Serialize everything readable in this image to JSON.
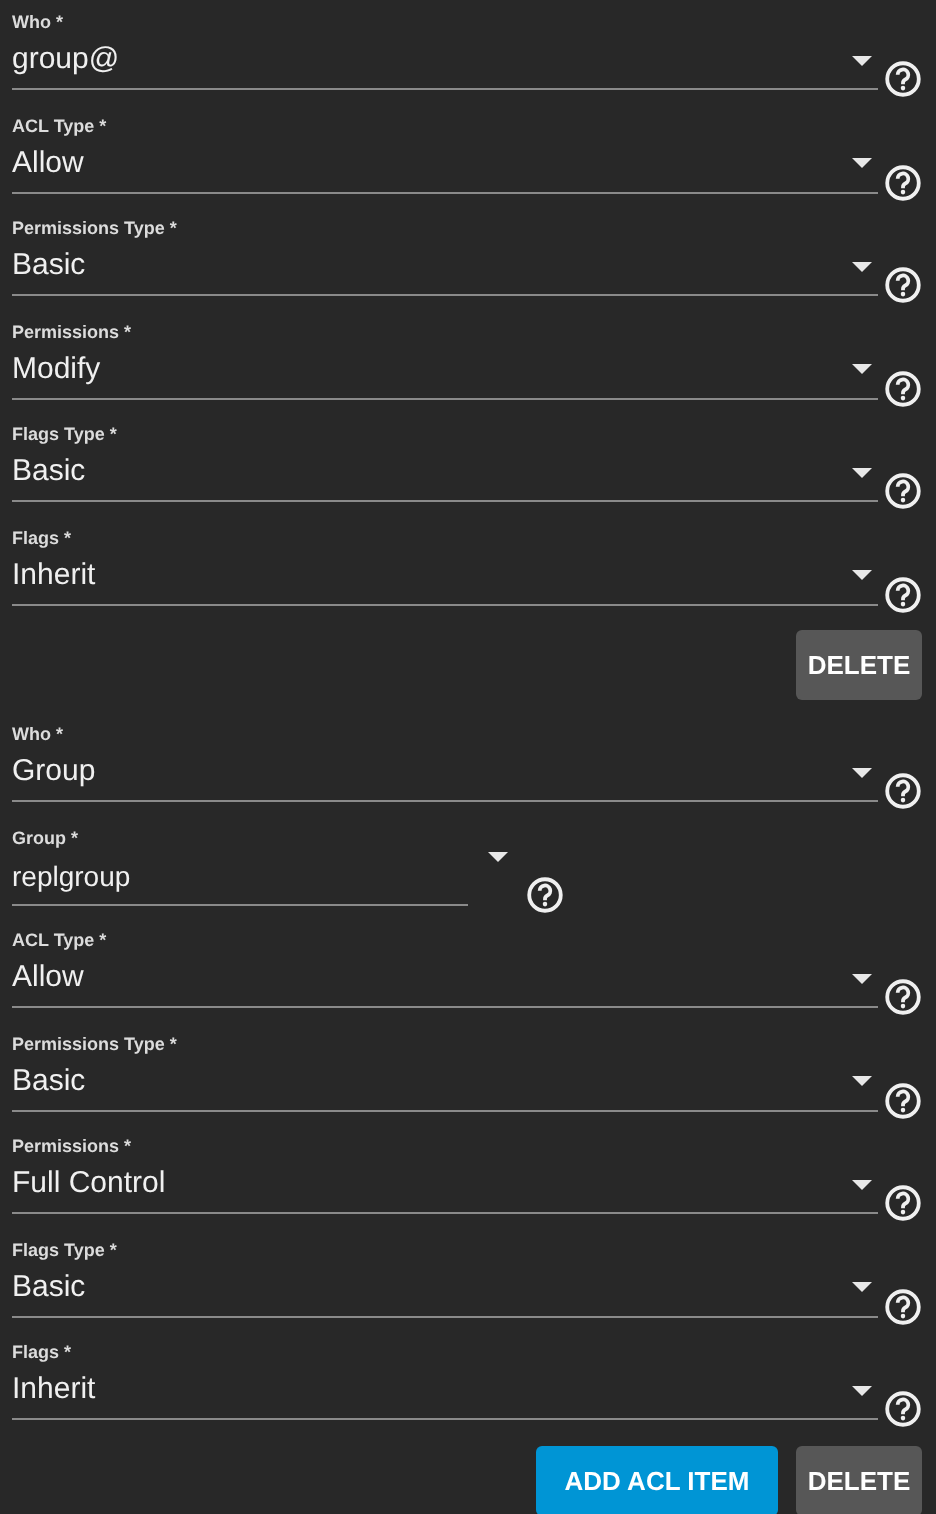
{
  "acl_entries": [
    {
      "fields": [
        {
          "kind": "select",
          "label": "Who *",
          "value": "group@"
        },
        {
          "kind": "select",
          "label": "ACL Type *",
          "value": "Allow"
        },
        {
          "kind": "select",
          "label": "Permissions Type *",
          "value": "Basic"
        },
        {
          "kind": "select",
          "label": "Permissions *",
          "value": "Modify"
        },
        {
          "kind": "select",
          "label": "Flags Type *",
          "value": "Basic"
        },
        {
          "kind": "select",
          "label": "Flags *",
          "value": "Inherit"
        }
      ],
      "buttons": [
        {
          "kind": "delete",
          "label": "DELETE"
        }
      ]
    },
    {
      "fields": [
        {
          "kind": "select",
          "label": "Who *",
          "value": "Group"
        },
        {
          "kind": "combo",
          "label": "Group *",
          "value": "replgroup"
        },
        {
          "kind": "select",
          "label": "ACL Type *",
          "value": "Allow"
        },
        {
          "kind": "select",
          "label": "Permissions Type *",
          "value": "Basic"
        },
        {
          "kind": "select",
          "label": "Permissions *",
          "value": "Full Control"
        },
        {
          "kind": "select",
          "label": "Flags Type *",
          "value": "Basic"
        },
        {
          "kind": "select",
          "label": "Flags *",
          "value": "Inherit"
        }
      ],
      "buttons": [
        {
          "kind": "add",
          "label": "ADD ACL ITEM"
        },
        {
          "kind": "delete",
          "label": "DELETE"
        }
      ]
    }
  ]
}
